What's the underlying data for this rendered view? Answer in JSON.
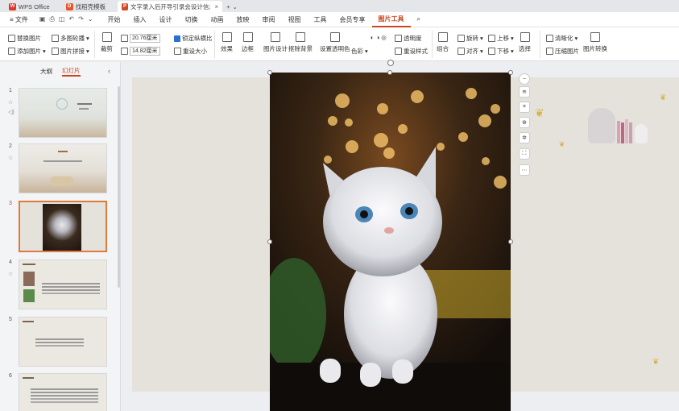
{
  "tabs": [
    {
      "label": "WPS Office",
      "icon": "wps-logo-icon"
    },
    {
      "label": "找稻壳模板",
      "icon": "docer-logo-icon"
    },
    {
      "label": "文字录入后开导引录会设计信息ppt",
      "icon": "ppt-logo-icon"
    }
  ],
  "menu": {
    "file": "文件",
    "items": [
      "开始",
      "插入",
      "设计",
      "切换",
      "动画",
      "放映",
      "审阅",
      "视图",
      "工具",
      "会员专享",
      "图片工具"
    ],
    "active": "图片工具"
  },
  "ribbon": {
    "replace_image": "替换图片",
    "multi_image": "多图轮播",
    "add_image": "添加图片",
    "image_collage": "图片拼接",
    "crop": "裁剪",
    "width_value": "20.76厘米",
    "height_value": "14.82厘米",
    "lock_ratio": "锁定纵横比",
    "reset_size": "重设大小",
    "effects": "效果",
    "border": "边框",
    "image_design": "图片设计",
    "remove_bg": "抠除背景",
    "set_transparent": "设置透明色",
    "color": "色彩",
    "transparency": "透明度",
    "reset_style": "重设样式",
    "combine": "组合",
    "rotate": "旋转",
    "align": "对齐",
    "up": "上移",
    "down": "下移",
    "select": "选择",
    "clarify": "清晰化",
    "compress": "压缩图片",
    "image_convert": "图片转换"
  },
  "leftpanel": {
    "tab_outline": "大纲",
    "tab_slides": "幻灯片",
    "slides": [
      {
        "num": "1"
      },
      {
        "num": "2"
      },
      {
        "num": "3"
      },
      {
        "num": "4"
      },
      {
        "num": "5"
      },
      {
        "num": "6"
      }
    ],
    "selected_slide": "3"
  },
  "colors": {
    "accent": "#c9461f",
    "selection": "#e07a3c"
  }
}
